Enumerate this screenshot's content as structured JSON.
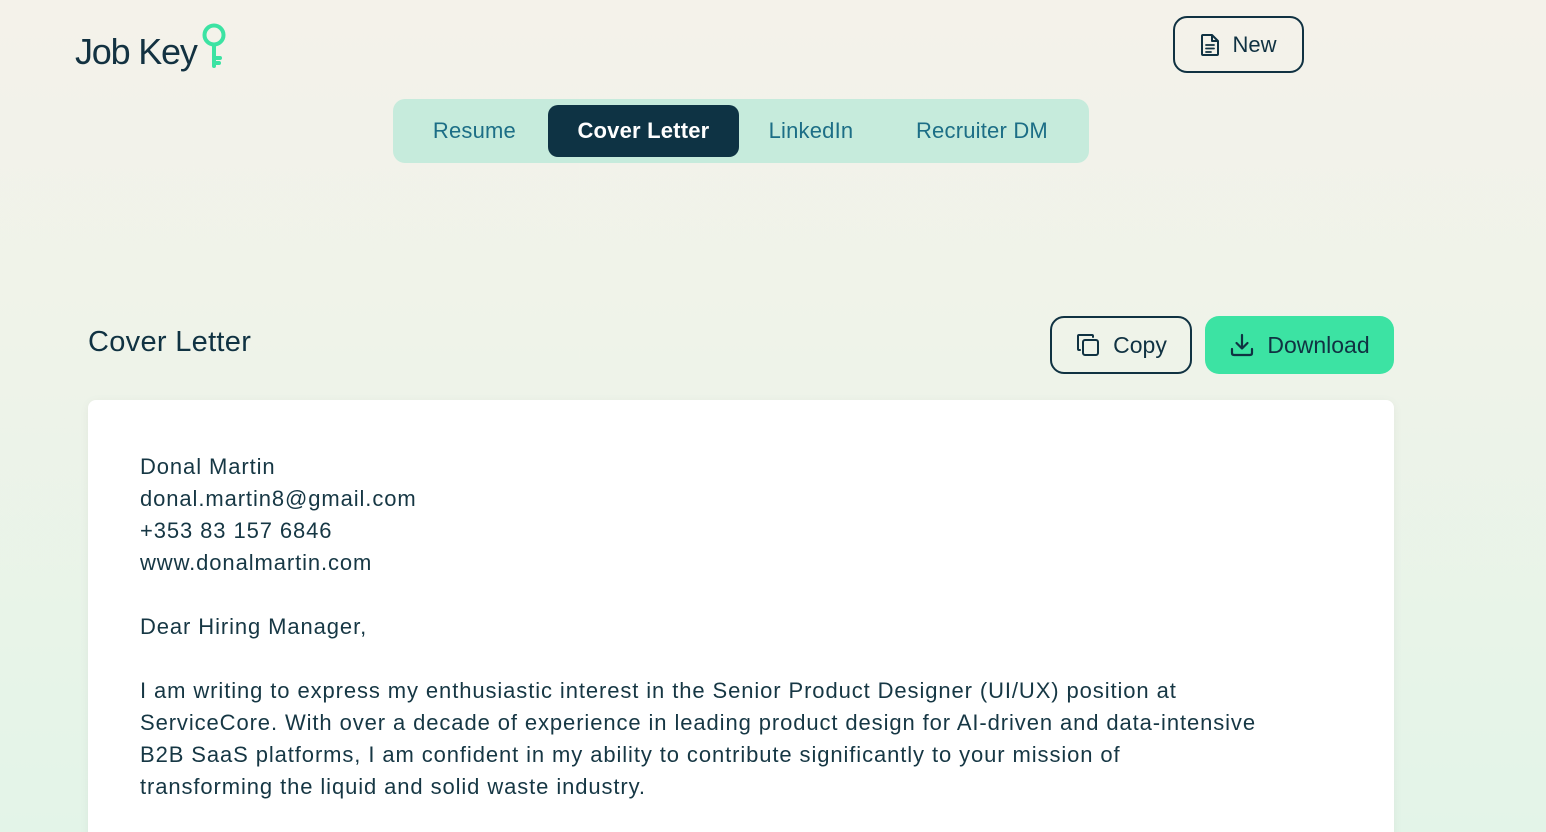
{
  "header": {
    "logo_text": "Job Key",
    "new_label": "New"
  },
  "tabs": [
    {
      "label": "Resume",
      "active": false
    },
    {
      "label": "Cover Letter",
      "active": true
    },
    {
      "label": "LinkedIn",
      "active": false
    },
    {
      "label": "Recruiter DM",
      "active": false
    }
  ],
  "section": {
    "title": "Cover Letter",
    "copy_label": "Copy",
    "download_label": "Download"
  },
  "letter": {
    "name": "Donal Martin",
    "email": "donal.martin8@gmail.com",
    "phone": "+353 83 157 6846",
    "website": "www.donalmartin.com",
    "salutation": "Dear Hiring Manager,",
    "paragraph1_lines": [
      "I am writing to express my enthusiastic interest in the Senior Product Designer (UI/UX) position at",
      "ServiceCore. With over a decade of experience in leading product design for AI-driven and data-intensive",
      "B2B SaaS platforms, I am confident in my ability to contribute significantly to your mission of",
      "transforming the liquid and solid waste industry."
    ]
  },
  "colors": {
    "primary_dark": "#0e3344",
    "accent_green": "#3ce3a3",
    "tab_bg": "#c6ebdc",
    "tab_text": "#1c6e86"
  },
  "icons": {
    "logo": "key-icon",
    "new": "document-icon",
    "copy": "copy-icon",
    "download": "download-icon"
  }
}
